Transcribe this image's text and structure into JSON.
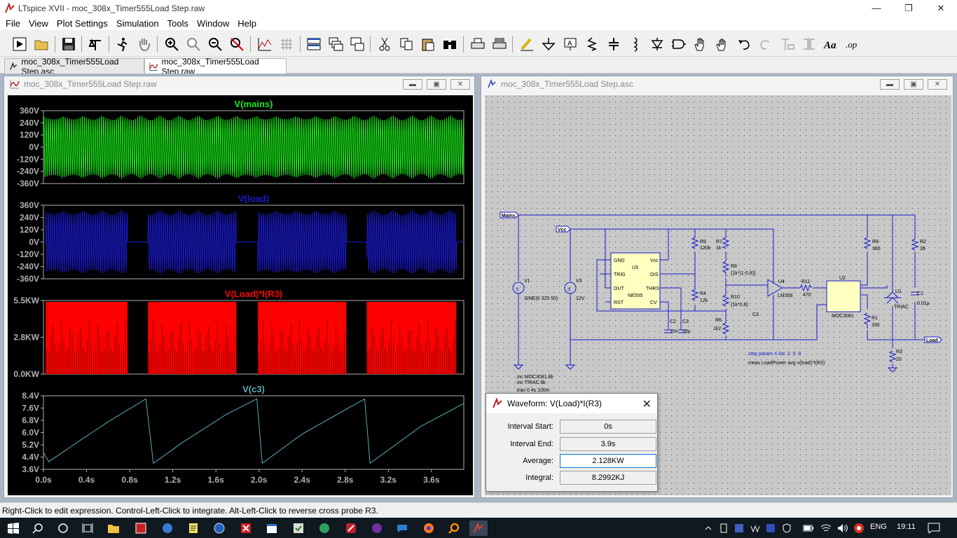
{
  "window": {
    "title": "LTspice XVII - moc_308x_Timer555Load Step.raw"
  },
  "menu": [
    "File",
    "View",
    "Plot Settings",
    "Simulation",
    "Tools",
    "Window",
    "Help"
  ],
  "tabs": [
    {
      "label": "moc_308x_Timer555Load Step.asc",
      "active": false
    },
    {
      "label": "moc_308x_Timer555Load Step.raw",
      "active": true
    }
  ],
  "plot_window": {
    "title": "moc_308x_Timer555Load Step.raw"
  },
  "schematic_window": {
    "title": "moc_308x_Timer555Load Step.asc"
  },
  "chart_data": [
    {
      "type": "line",
      "title": "V(mains)",
      "color": "#18e818",
      "ylabels": [
        "360V",
        "240V",
        "120V",
        "0V",
        "-120V",
        "-240V",
        "-360V"
      ],
      "ylim": [
        -360,
        360
      ],
      "xlim": [
        0,
        3.9
      ],
      "description": "50 Hz sine, amplitude 325 V, continuous"
    },
    {
      "type": "line",
      "title": "V(load)",
      "color": "#1a1ad0",
      "ylabels": [
        "360V",
        "240V",
        "120V",
        "0V",
        "-120V",
        "-240V",
        "-360V"
      ],
      "ylim": [
        -360,
        360
      ],
      "xlim": [
        0,
        3.9
      ],
      "on_intervals": [
        [
          0.02,
          0.78
        ],
        [
          0.97,
          1.79
        ],
        [
          1.99,
          2.81
        ],
        [
          3.0,
          3.83
        ]
      ]
    },
    {
      "type": "area",
      "title": "V(Load)*I(R3)",
      "color": "#ff0000",
      "ylabels": [
        "5.5KW",
        "2.8KW",
        "0.0KW"
      ],
      "ylim": [
        0,
        5.5
      ],
      "xlim": [
        0,
        3.9
      ],
      "on_intervals": [
        [
          0.02,
          0.78
        ],
        [
          0.97,
          1.79
        ],
        [
          1.99,
          2.81
        ],
        [
          3.0,
          3.83
        ]
      ]
    },
    {
      "type": "line",
      "title": "V(c3)",
      "color": "#5aaab8",
      "ylabels": [
        "8.4V",
        "7.6V",
        "6.8V",
        "6.0V",
        "5.2V",
        "4.4V",
        "3.6V"
      ],
      "ylim": [
        3.6,
        8.4
      ],
      "xlim": [
        0,
        3.9
      ],
      "x": [
        0.0,
        0.05,
        0.3,
        0.6,
        0.95,
        1.02,
        1.3,
        1.7,
        1.98,
        2.03,
        2.4,
        2.98,
        3.03,
        3.5,
        3.9
      ],
      "y": [
        4.7,
        4.1,
        5.3,
        6.7,
        8.2,
        4.0,
        5.4,
        7.2,
        8.2,
        4.0,
        5.9,
        8.2,
        4.0,
        6.4,
        7.9
      ],
      "xlabels": [
        "0.0s",
        "0.4s",
        "0.8s",
        "1.2s",
        "1.6s",
        "2.0s",
        "2.4s",
        "2.8s",
        "3.2s",
        "3.6s"
      ]
    }
  ],
  "schematic": {
    "nets": [
      "Mains",
      "Vcc",
      "Load"
    ],
    "components": [
      {
        "ref": "V1",
        "value": "SINE(0 325 50)"
      },
      {
        "ref": "V3",
        "value": "12V"
      },
      {
        "ref": "U3",
        "value": "NE555",
        "pins": [
          "GND",
          "TRIG",
          "OUT",
          "RST",
          "Vcc",
          "DIS",
          "THRS",
          "CV"
        ]
      },
      {
        "ref": "R5",
        "value": "120k"
      },
      {
        "ref": "R7",
        "value": "1k"
      },
      {
        "ref": "R8",
        "value": "{1k*(1-0.8)}"
      },
      {
        "ref": "R4",
        "value": "12k"
      },
      {
        "ref": "R10",
        "value": "{1k*0.8}"
      },
      {
        "ref": "R6",
        "value": "1k2"
      },
      {
        "ref": "C2",
        "value": "10n"
      },
      {
        "ref": "C3",
        "value": "10µ"
      },
      {
        "ref": "U4",
        "value": "LM358"
      },
      {
        "ref": "R11",
        "value": "470"
      },
      {
        "ref": "U2",
        "value": "MOC3081"
      },
      {
        "ref": "R9",
        "value": "360"
      },
      {
        "ref": "R1",
        "value": "330"
      },
      {
        "ref": "U1",
        "value": "TRIAC"
      },
      {
        "ref": "R2",
        "value": "39"
      },
      {
        "ref": "C1",
        "value": "0.01µ"
      },
      {
        "ref": "R3",
        "value": "20"
      }
    ],
    "directives": [
      ".inc MOC3081.lib",
      ".inc TRIAC.lib",
      ".tran 0 4s 100m",
      ".step param X list .2 .5 .8",
      ".meas LoadPower avg v(load)*I(R3)"
    ]
  },
  "dialog": {
    "title": "Waveform: V(Load)*I(R3)",
    "rows": [
      {
        "label": "Interval Start:",
        "value": "0s"
      },
      {
        "label": "Interval End:",
        "value": "3.9s"
      },
      {
        "label": "Average:",
        "value": "2.128KW"
      },
      {
        "label": "Integral:",
        "value": "8.2992KJ"
      }
    ]
  },
  "status": {
    "text": "Right-Click to edit expression. Control-Left-Click to integrate. Alt-Left-Click to reverse cross probe R3."
  },
  "taskbar": {
    "language": "ENG",
    "time": "19:11"
  }
}
